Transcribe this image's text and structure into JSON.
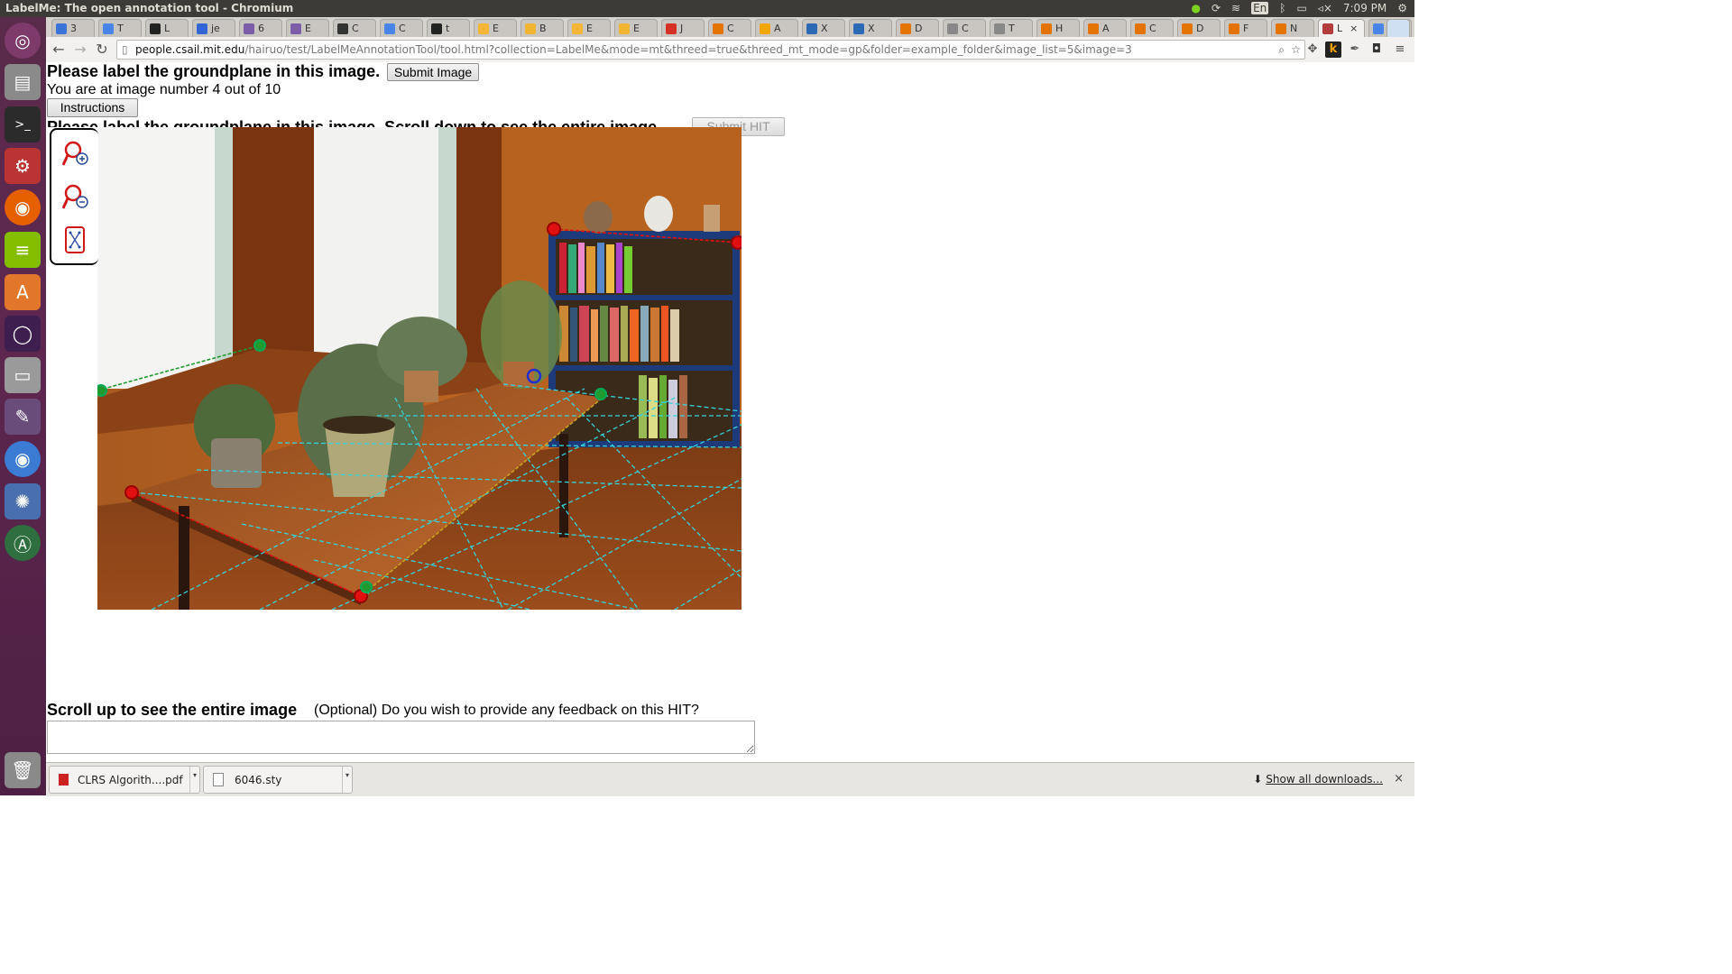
{
  "window": {
    "title": "LabelMe: The open annotation tool - Chromium",
    "time": "7:09 PM",
    "keyboard": "En"
  },
  "tabs": [
    {
      "label": "3",
      "color": "#3b73d8"
    },
    {
      "label": "T",
      "color": "#4a86e8"
    },
    {
      "label": "L",
      "color": "#222222"
    },
    {
      "label": "je",
      "color": "#3367d6"
    },
    {
      "label": "6",
      "color": "#7b5ea7"
    },
    {
      "label": "E",
      "color": "#7b5ea7"
    },
    {
      "label": "C",
      "color": "#333333"
    },
    {
      "label": "C",
      "color": "#4a86e8"
    },
    {
      "label": "t",
      "color": "#222222"
    },
    {
      "label": "E",
      "color": "#f2b632"
    },
    {
      "label": "B",
      "color": "#f2b632"
    },
    {
      "label": "E",
      "color": "#f2b632"
    },
    {
      "label": "E",
      "color": "#f2b632"
    },
    {
      "label": "J",
      "color": "#d93025"
    },
    {
      "label": "C",
      "color": "#e37400"
    },
    {
      "label": "A",
      "color": "#f2a600"
    },
    {
      "label": "X",
      "color": "#2d6ab4"
    },
    {
      "label": "X",
      "color": "#2d6ab4"
    },
    {
      "label": "D",
      "color": "#e37400"
    },
    {
      "label": "C",
      "color": "#888888"
    },
    {
      "label": "T",
      "color": "#888888"
    },
    {
      "label": "H",
      "color": "#e37400"
    },
    {
      "label": "A",
      "color": "#e37400"
    },
    {
      "label": "C",
      "color": "#e37400"
    },
    {
      "label": "D",
      "color": "#e37400"
    },
    {
      "label": "F",
      "color": "#e37400"
    },
    {
      "label": "N",
      "color": "#e37400"
    },
    {
      "label": "L",
      "color": "#b23b3b",
      "active": true
    },
    {
      "label": "C",
      "color": "#4a86e8"
    }
  ],
  "address": {
    "host": "people.csail.mit.edu",
    "path": "/hairuo/test/LabelMeAnnotationTool/tool.html?collection=LabelMe&mode=mt&threed=true&threed_mt_mode=gp&folder=example_folder&image_list=5&image=3"
  },
  "page": {
    "heading": "Please label the groundplane in this image.",
    "submit_image": "Submit Image",
    "image_number": "You are at image number 4 out of 10",
    "instructions": "Instructions",
    "heading2": "Please label the groundplane in this image. Scroll down to see the entire image.",
    "submit_hit": "Submit HIT",
    "scroll_up": "Scroll up to see the entire image",
    "feedback_question": "(Optional) Do you wish to provide any feedback on this HIT?",
    "feedback_value": ""
  },
  "zoom_tools": [
    "zoom-in-icon",
    "zoom-out-icon",
    "fit-to-screen-icon"
  ],
  "downloads": [
    {
      "name": "CLRS Algorith....pdf",
      "icon": "pdf-icon"
    },
    {
      "name": "6046.sty",
      "icon": "file-icon"
    }
  ],
  "downloads_link": "Show all downloads...",
  "colors": {
    "launcher": "#5e2750",
    "grid": "#36d2d8",
    "control_red": "#e01010",
    "control_green": "#1f9a2f",
    "control_blue": "#2030d0"
  }
}
